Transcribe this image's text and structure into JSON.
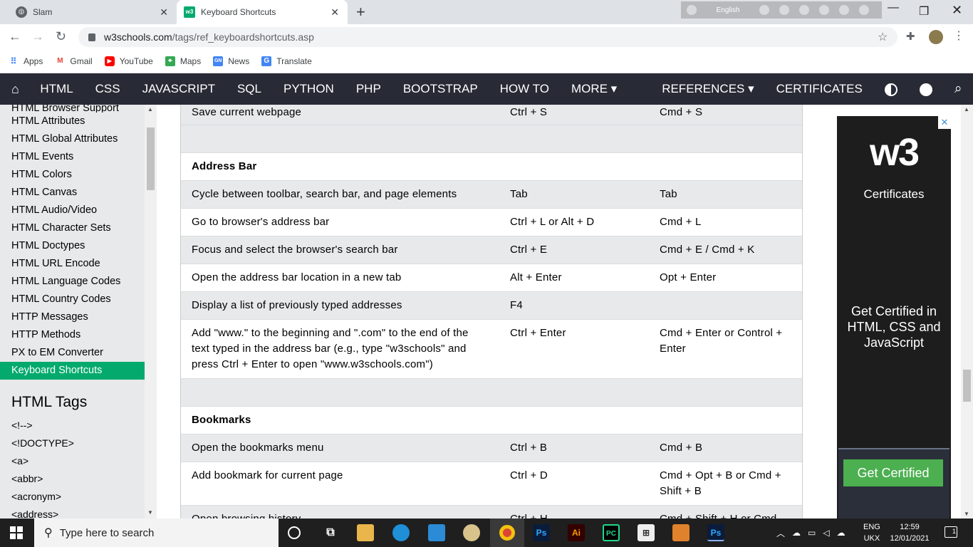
{
  "browser": {
    "tabs": [
      {
        "title": "Slam",
        "icon": "globe-icon"
      },
      {
        "title": "Keyboard Shortcuts",
        "icon": "w3schools-favicon"
      }
    ],
    "ime_language": "English",
    "url_host": "w3schools.com",
    "url_path": "/tags/ref_keyboardshortcuts.asp",
    "bookmarks": [
      {
        "label": "Apps",
        "icon": "apps-grid-icon"
      },
      {
        "label": "Gmail",
        "icon": "gmail-icon"
      },
      {
        "label": "YouTube",
        "icon": "youtube-icon"
      },
      {
        "label": "Maps",
        "icon": "maps-icon"
      },
      {
        "label": "News",
        "icon": "news-icon"
      },
      {
        "label": "Translate",
        "icon": "translate-icon"
      }
    ]
  },
  "topnav": {
    "items": [
      "HTML",
      "CSS",
      "JAVASCRIPT",
      "SQL",
      "PYTHON",
      "PHP",
      "BOOTSTRAP",
      "HOW TO",
      "MORE ▾"
    ],
    "right_items": [
      "REFERENCES ▾",
      "CERTIFICATES"
    ]
  },
  "sidebar": {
    "links": [
      "HTML Browser Support",
      "HTML Attributes",
      "HTML Global Attributes",
      "HTML Events",
      "HTML Colors",
      "HTML Canvas",
      "HTML Audio/Video",
      "HTML Character Sets",
      "HTML Doctypes",
      "HTML URL Encode",
      "HTML Language Codes",
      "HTML Country Codes",
      "HTTP Messages",
      "HTTP Methods",
      "PX to EM Converter",
      "Keyboard Shortcuts"
    ],
    "active": "Keyboard Shortcuts",
    "tags_heading": "HTML Tags",
    "tags": [
      "<!-->",
      "<!DOCTYPE>",
      "<a>",
      "<abbr>",
      "<acronym>",
      "<address>"
    ]
  },
  "shortcuts": {
    "top_row": {
      "desc": "Save current webpage",
      "win": "Ctrl + S",
      "mac": "Cmd + S"
    },
    "address_bar_title": "Address Bar",
    "address_bar": [
      {
        "desc": "Cycle between toolbar, search bar, and page elements",
        "win": "Tab",
        "mac": "Tab"
      },
      {
        "desc": "Go to browser's address bar",
        "win": "Ctrl + L or Alt + D",
        "mac": "Cmd + L"
      },
      {
        "desc": "Focus and select the browser's search bar",
        "win": "Ctrl + E",
        "mac": "Cmd + E / Cmd + K"
      },
      {
        "desc": "Open the address bar location in a new tab",
        "win": "Alt + Enter",
        "mac": "Opt + Enter"
      },
      {
        "desc": "Display a list of previously typed addresses",
        "win": "F4",
        "mac": ""
      },
      {
        "desc": "Add \"www.\" to the beginning and \".com\" to the end of the text typed in the address bar (e.g., type \"w3schools\" and press Ctrl + Enter to open \"www.w3schools.com\")",
        "win": "Ctrl + Enter",
        "mac": "Cmd + Enter or Control + Enter"
      }
    ],
    "bookmarks_title": "Bookmarks",
    "bookmarks": [
      {
        "desc": "Open the bookmarks menu",
        "win": "Ctrl + B",
        "mac": "Cmd + B"
      },
      {
        "desc": "Add bookmark for current page",
        "win": "Ctrl + D",
        "mac": "Cmd + Opt + B or Cmd + Shift + B"
      },
      {
        "desc": "Open browsing history",
        "win": "Ctrl + H",
        "mac": "Cmd + Shift + H or Cmd"
      }
    ]
  },
  "ad": {
    "logo": "w3",
    "subtitle": "Certificates",
    "tagline": "Get Certified in HTML, CSS and JavaScript",
    "button": "Get Certified"
  },
  "taskbar": {
    "search_placeholder": "Type here to search",
    "lang_top": "ENG",
    "lang_bottom": "UKX",
    "time": "12:59",
    "date": "12/01/2021",
    "notifications": "1",
    "pinned_apps": [
      "task-view-icon",
      "file-explorer-icon",
      "edge-icon",
      "vscode-icon",
      "paint-icon",
      "chrome-icon",
      "photoshop-icon",
      "illustrator-icon",
      "pycharm-icon",
      "store-icon",
      "uc-app-icon",
      "photoshop-icon"
    ]
  }
}
